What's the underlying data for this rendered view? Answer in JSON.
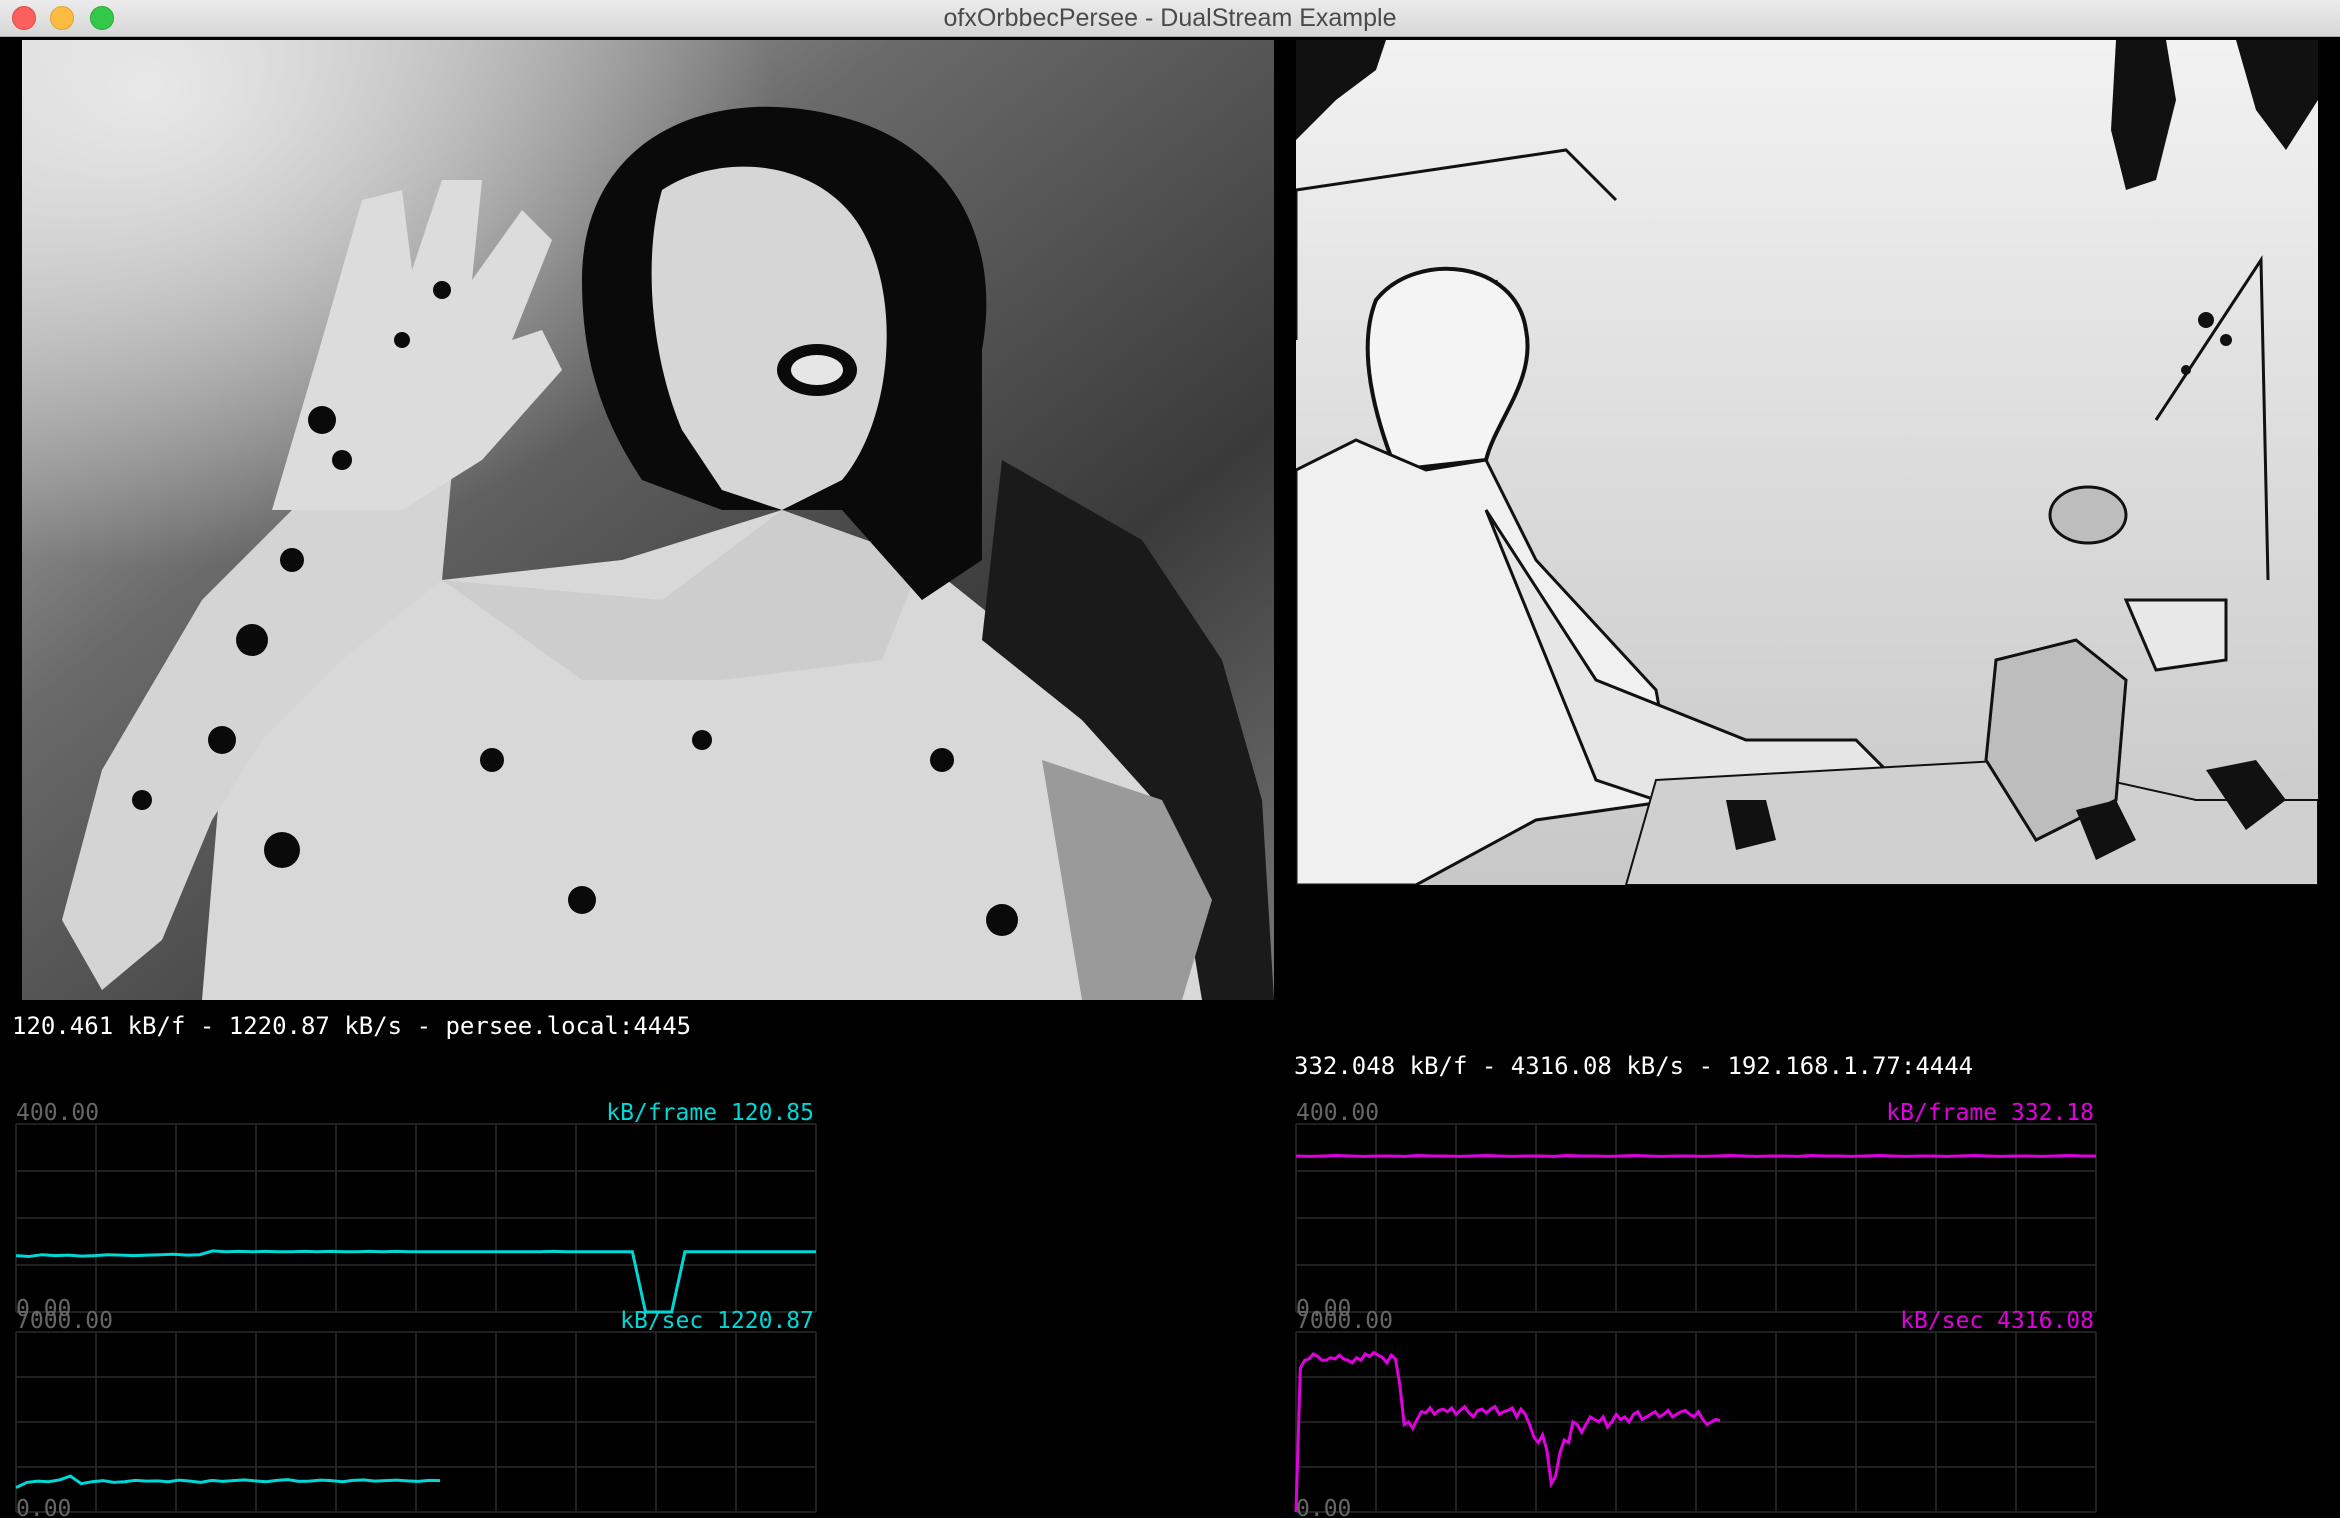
{
  "window": {
    "title": "ofxOrbbecPersee - DualStream Example"
  },
  "left": {
    "info": "120.461 kB/f - 1220.87 kB/s - persee.local:4445",
    "color": "#00d8d8",
    "frame_graph": {
      "label": "kB/frame 120.85",
      "ymax": "400.00",
      "ymin": "0.00",
      "values": [
        120,
        118,
        122,
        120,
        121,
        119,
        120,
        122,
        121,
        120,
        121,
        122,
        123,
        121,
        122,
        130,
        128,
        129,
        128,
        129,
        128,
        128,
        129,
        128,
        129,
        128,
        128,
        129,
        128,
        129,
        128,
        128,
        128,
        128,
        128,
        128,
        128,
        128,
        128,
        128,
        128,
        129,
        128,
        128,
        128,
        128,
        128,
        128,
        0,
        0,
        0,
        128,
        128,
        128,
        128,
        128,
        128,
        128,
        128,
        128,
        128,
        128
      ]
    },
    "sec_graph": {
      "label": "kB/sec 1220.87",
      "ymax": "7000.00",
      "ymin": "0.00",
      "values": [
        950,
        1150,
        1200,
        1180,
        1250,
        1400,
        1100,
        1180,
        1220,
        1150,
        1180,
        1230,
        1200,
        1210,
        1180,
        1240,
        1200,
        1150,
        1230,
        1190,
        1220,
        1250,
        1210,
        1180,
        1230,
        1260,
        1190,
        1200,
        1240,
        1220,
        1180,
        1230,
        1250,
        1200,
        1220,
        1240,
        1210,
        1190,
        1230,
        1220
      ]
    }
  },
  "right": {
    "info": "332.048 kB/f - 4316.08 kB/s - 192.168.1.77:4444",
    "color": "#e000e0",
    "frame_graph": {
      "label": "kB/frame 332.18",
      "ymax": "400.00",
      "ymin": "0.00",
      "values": [
        332,
        331,
        332,
        333,
        332,
        331,
        332,
        332,
        331,
        333,
        332,
        332,
        331,
        332,
        333,
        332,
        331,
        332,
        332,
        331,
        333,
        332,
        332,
        331,
        332,
        333,
        332,
        331,
        332,
        332,
        331,
        332,
        333,
        332,
        331,
        332,
        332,
        331,
        333,
        332,
        332,
        331,
        332,
        333,
        332,
        331,
        332,
        332,
        331,
        332,
        333,
        332,
        331,
        332,
        332,
        331,
        332,
        333,
        332,
        332
      ]
    },
    "sec_graph": {
      "label": "kB/sec 4316.08",
      "ymax": "7000.00",
      "ymin": "0.00",
      "values": [
        0,
        5600,
        5900,
        5950,
        6150,
        6050,
        5900,
        5900,
        6000,
        5950,
        6100,
        5950,
        5900,
        5800,
        6000,
        5900,
        6150,
        6050,
        6200,
        6100,
        6000,
        5800,
        6100,
        5950,
        4950,
        3400,
        3500,
        3250,
        3600,
        3900,
        3850,
        4050,
        3800,
        3950,
        4000,
        3900,
        4050,
        3800,
        3950,
        4100,
        3850,
        3700,
        3950,
        4000,
        3850,
        4000,
        4100,
        3800,
        3900,
        3950,
        4050,
        3700,
        4000,
        3800,
        3400,
        2900,
        2700,
        3000,
        2400,
        1100,
        1400,
        2300,
        2800,
        2700,
        3500,
        3400,
        3100,
        3400,
        3700,
        3600,
        3500,
        3700,
        3300,
        3500,
        3800,
        3600,
        3700,
        3500,
        3800,
        3900,
        3600,
        3700,
        3800,
        3900,
        3700,
        3800,
        3950,
        3700,
        3800,
        3900,
        3950,
        3800,
        3700,
        3900,
        3600,
        3400,
        3500,
        3600,
        3550
      ]
    }
  }
}
